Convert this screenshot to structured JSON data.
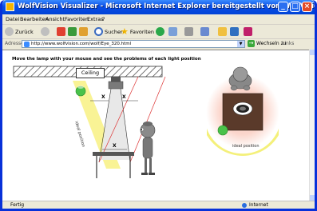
{
  "window": {
    "title": "WolfVision Visualizer - Microsoft Internet Explorer bereitgestellt von WolfVision Austria"
  },
  "menu": [
    "Datei",
    "Bearbeiten",
    "Ansicht",
    "Favoriten",
    "Extras",
    "?"
  ],
  "toolbar": {
    "back": "Zurück",
    "search": "Suchen",
    "favorites": "Favoriten"
  },
  "address": {
    "label": "Adresse",
    "url": "http://www.wolfvision.com/wolf/Eye_320.html",
    "go": "Wechseln zu",
    "links": "Links"
  },
  "page": {
    "instruction": "Move the lamp with your mouse and see the problems of each light position",
    "ceiling": "Ceiling",
    "ideal_side": "ideal position",
    "ideal_top": "ideal position",
    "x1": "X",
    "x2": "X",
    "x3": "X"
  },
  "status": {
    "left": "Fertig",
    "zone": "Internet"
  }
}
